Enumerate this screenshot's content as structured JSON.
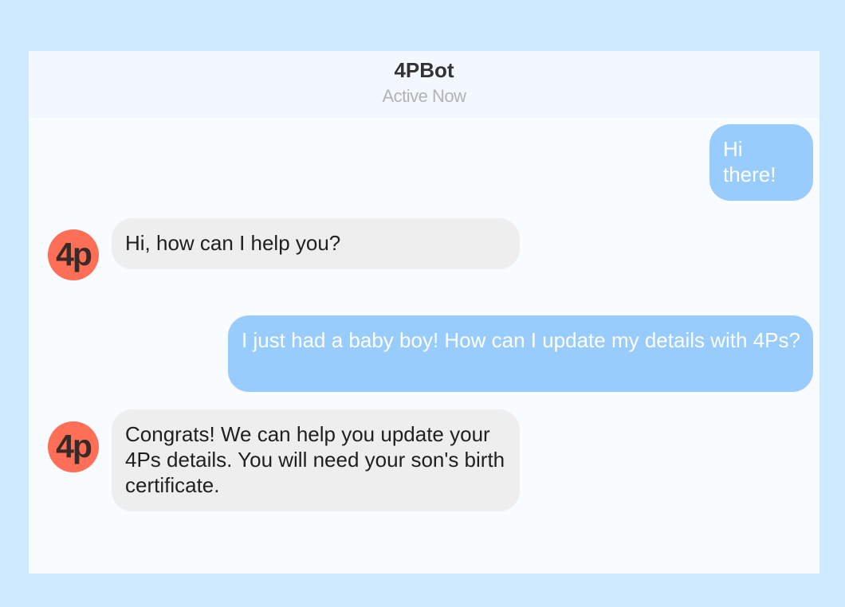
{
  "header": {
    "bot_name": "4PBot",
    "status": "Active Now"
  },
  "messages": [
    {
      "sender": "user",
      "text": "Hi there!"
    },
    {
      "sender": "bot",
      "avatar": "4p",
      "text": "Hi, how can I help you?"
    },
    {
      "sender": "user",
      "text": "I just had a baby boy! How can I update my details with 4Ps?"
    },
    {
      "sender": "bot",
      "avatar": "4p",
      "text": "Congrats! We can help you update your 4Ps details. You will need your son's birth certificate."
    }
  ],
  "colors": {
    "page_background": "#cfeaff",
    "user_bubble": "#98ccfd",
    "bot_bubble": "#eeeeee",
    "avatar": "#ff6f58"
  }
}
